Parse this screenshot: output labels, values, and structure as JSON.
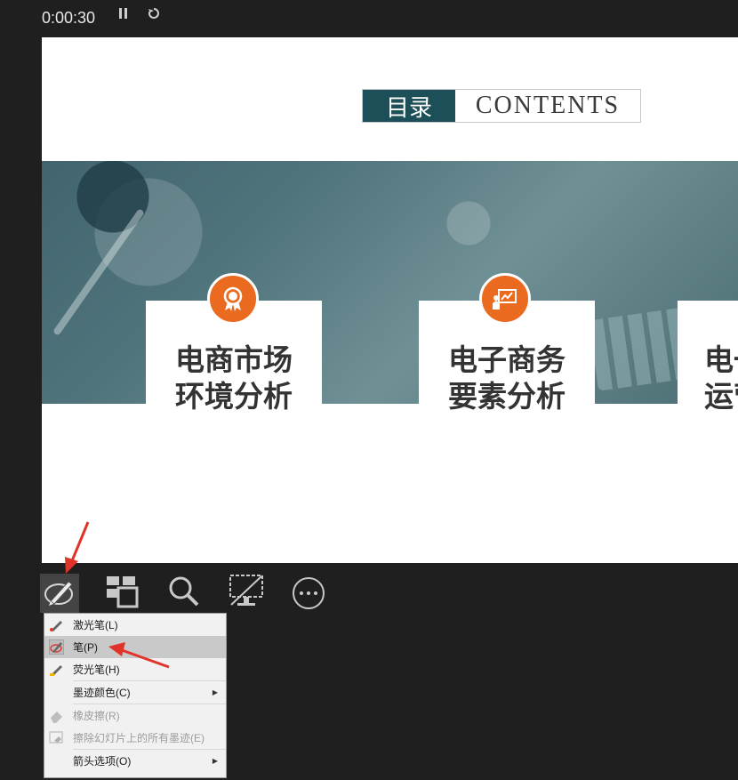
{
  "timer": {
    "elapsed": "0:00:30",
    "pause_glyph": "⏸",
    "restart_glyph": "↻"
  },
  "slide": {
    "toc_cn": "目录",
    "toc_en": "CONTENTS",
    "cards": [
      {
        "label": "电商市场\n环境分析",
        "icon": "award-ribbon-icon"
      },
      {
        "label": "电子商务\n要素分析",
        "icon": "presentation-chart-icon"
      },
      {
        "label": "电一\n运营",
        "icon": ""
      }
    ],
    "accent_color": "#ea6a1f",
    "header_color": "#1c4f58"
  },
  "toolbar": {
    "items": [
      "pen-tool-icon",
      "slide-navigator-icon",
      "zoom-icon",
      "screen-options-icon",
      "more-options-icon"
    ]
  },
  "pen_menu": {
    "items": [
      {
        "label": "激光笔(L)",
        "state": "normal"
      },
      {
        "label": "笔(P)",
        "state": "selected"
      },
      {
        "label": "荧光笔(H)",
        "state": "normal"
      },
      {
        "label": "墨迹颜色(C)",
        "state": "submenu"
      },
      {
        "label": "橡皮擦(R)",
        "state": "disabled"
      },
      {
        "label": "擦除幻灯片上的所有墨迹(E)",
        "state": "disabled"
      },
      {
        "label": "箭头选项(O)",
        "state": "submenu"
      }
    ]
  },
  "annotation_color": "#e0332a"
}
